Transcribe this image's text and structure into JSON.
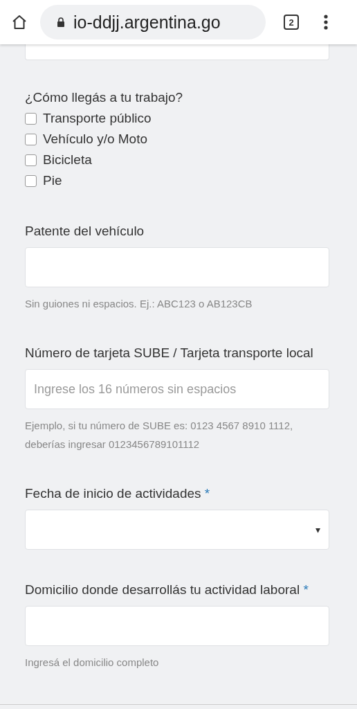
{
  "browser_bar": {
    "url": "io-ddjj.argentina.go",
    "secure": true,
    "tab_count": "2"
  },
  "commute": {
    "question": "¿Cómo llegás a tu trabajo?",
    "options": [
      {
        "label": "Transporte público",
        "checked": false
      },
      {
        "label": "Vehículo y/o Moto",
        "checked": false
      },
      {
        "label": "Bicicleta",
        "checked": false
      },
      {
        "label": "Pie",
        "checked": false
      }
    ]
  },
  "fields": [
    {
      "kind": "text",
      "label": "Patente del vehículo",
      "hint": "Sin guiones ni espacios. Ej.: ABC123 o AB123CB"
    },
    {
      "kind": "text",
      "label": "Número de tarjeta SUBE / Tarjeta transporte local",
      "placeholder": "Ingrese los 16 números sin espacios",
      "hint": "Ejemplo, si tu número de SUBE es: 0123 4567 8910 1112, deberías ingresar 0123456789101112"
    },
    {
      "kind": "select",
      "label": "Fecha de inicio de actividades",
      "required_mark": "*",
      "arrow": "▾"
    },
    {
      "kind": "text",
      "label": "Domicilio donde desarrollás tu actividad laboral",
      "required_mark": "*",
      "hint": "Ingresá el domicilio completo"
    }
  ]
}
